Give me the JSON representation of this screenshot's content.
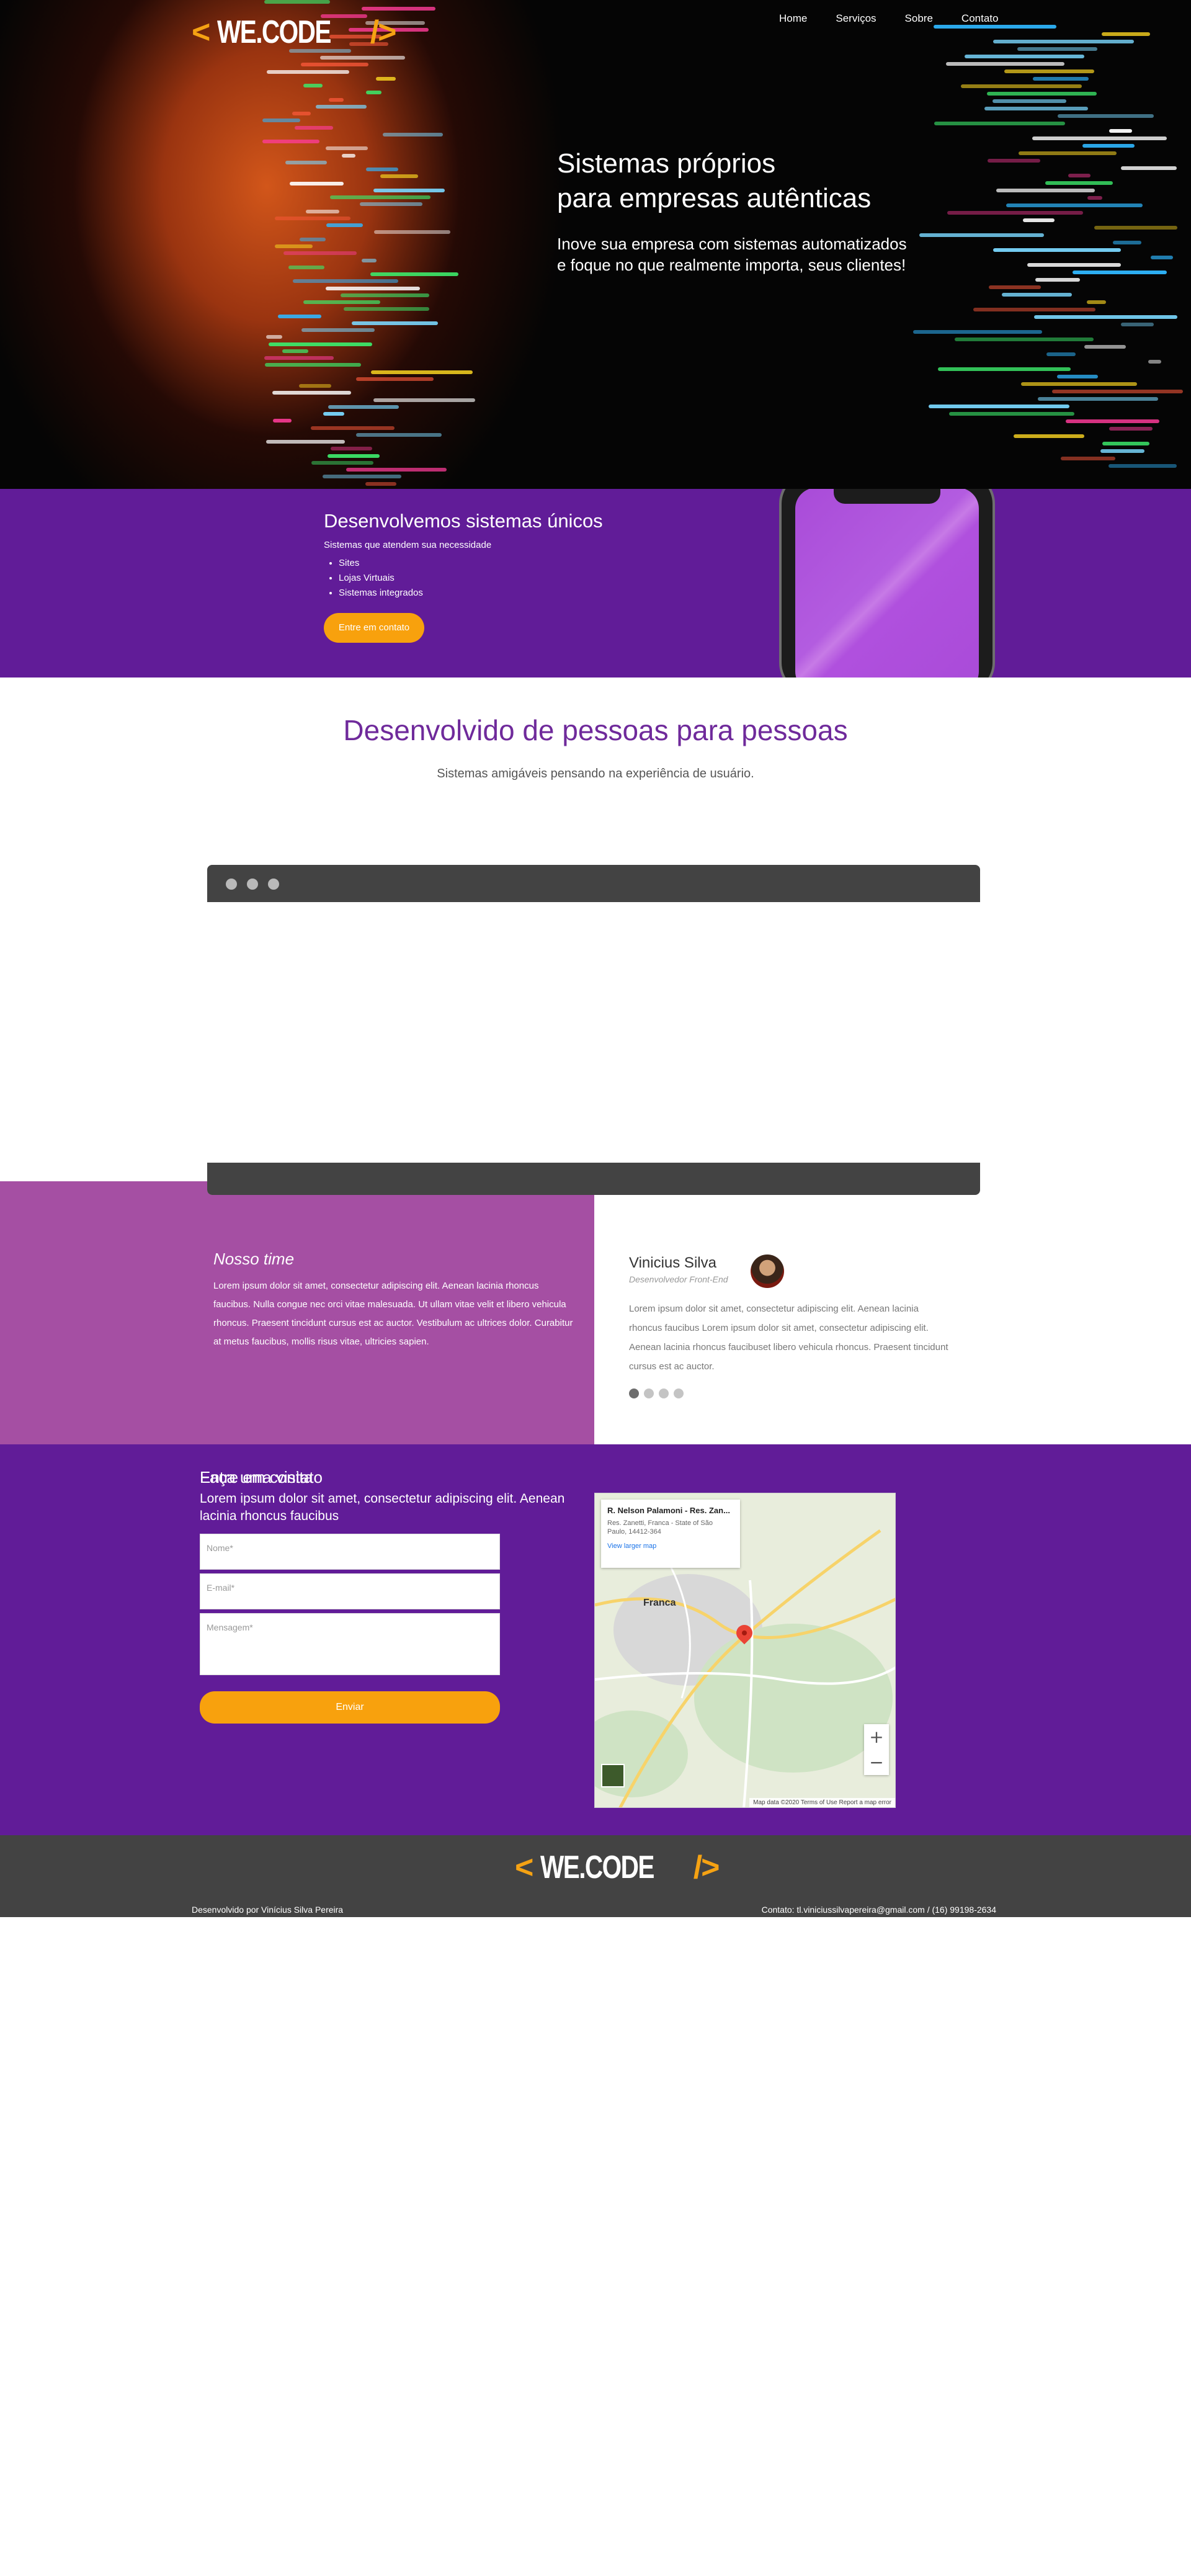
{
  "brand": {
    "logo_open": "<",
    "logo_text": "WE.CODE",
    "logo_close": "/>",
    "accent": "#f5a213",
    "purple": "#611c98",
    "pink": "#a54fa3"
  },
  "nav": {
    "items": [
      {
        "label": "Home"
      },
      {
        "label": "Serviços"
      },
      {
        "label": "Sobre"
      },
      {
        "label": "Contato"
      }
    ]
  },
  "hero": {
    "title_line1": "Sistemas próprios",
    "title_line2": "para empresas autênticas",
    "subtitle_line1": "Inove sua empresa com sistemas automatizados",
    "subtitle_line2": "e foque no que realmente importa, seus clientes!"
  },
  "services": {
    "title": "Desenvolvemos sistemas únicos",
    "lead": "Sistemas que atendem sua necessidade",
    "items": [
      "Sites",
      "Lojas Virtuais",
      "Sistemas integrados"
    ],
    "button": "Entre em contato"
  },
  "people": {
    "title": "Desenvolvido de pessoas para pessoas",
    "subtitle": "Sistemas amigáveis pensando na experiência de usuário."
  },
  "testimonials": {
    "team_title": "Nosso time",
    "team_text": "Lorem ipsum dolor sit amet, consectetur adipiscing elit. Aenean lacinia rhoncus faucibus. Nulla congue nec orci vitae malesuada. Ut ullam vitae velit et libero vehicula rhoncus. Praesent tincidunt cursus est ac auctor. Vestibulum ac ultrices dolor. Curabitur at metus faucibus, mollis risus vitae, ultricies sapien.",
    "person_name": "Vinicius Silva",
    "person_role": "Desenvolvedor Front-End",
    "person_text": "Lorem ipsum dolor sit amet, consectetur adipiscing elit. Aenean lacinia rhoncus faucibus Lorem ipsum dolor sit amet, consectetur adipiscing elit. Aenean lacinia rhoncus faucibuset libero vehicula rhoncus. Praesent tincidunt cursus est ac auctor.",
    "slides": 4,
    "active_slide": 1
  },
  "contact": {
    "title": "Entre em contato",
    "lead": "Lorem ipsum dolor sit amet, consectetur adipiscing elit. Aenean lacinia rhoncus faucibus",
    "name_placeholder": "Nome*",
    "email_placeholder": "E-mail*",
    "message_placeholder": "Mensagem*",
    "submit": "Enviar"
  },
  "visit": {
    "title": "Faça uma visita",
    "place_name": "R. Nelson Palamoni - Res. Zan...",
    "place_address": "Res. Zanetti, Franca - State of São Paulo, 14412-364",
    "view_larger": "View larger map",
    "city": "Franca",
    "zoom_in": "+",
    "zoom_out": "−",
    "attribution": "Map data ©2020   Terms of Use   Report a map error"
  },
  "footer": {
    "credit": "Desenvolvido por Vinícius Silva Pereira",
    "contact": "Contato: tl.viniciussilvapereira@gmail.com / (16) 99198-2634"
  }
}
